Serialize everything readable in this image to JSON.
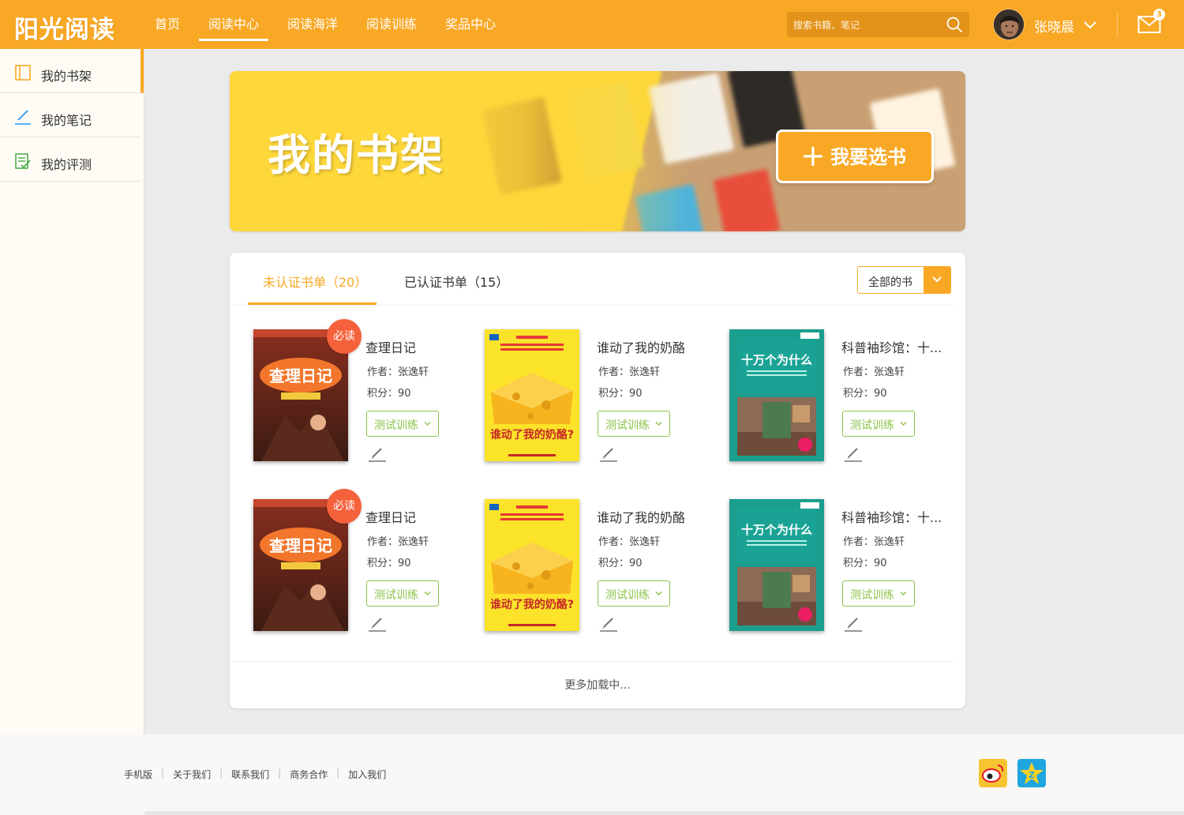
{
  "header": {
    "logo": "阳光阅读",
    "nav": [
      {
        "label": "首页",
        "active": false
      },
      {
        "label": "阅读中心",
        "active": true
      },
      {
        "label": "阅读海洋",
        "active": false
      },
      {
        "label": "阅读训练",
        "active": false
      },
      {
        "label": "奖品中心",
        "active": false
      }
    ],
    "search": {
      "placeholder": "搜索书籍、笔记",
      "icon": "search-icon"
    },
    "user": {
      "name": "张晓晨",
      "icon": "chevron-down-icon"
    },
    "mail": {
      "badge": "3",
      "icon": "mail-icon"
    }
  },
  "sidebar": {
    "items": [
      {
        "label": "我的书架",
        "icon": "bookshelf-icon",
        "active": true
      },
      {
        "label": "我的笔记",
        "icon": "pen-icon",
        "active": false
      },
      {
        "label": "我的评测",
        "icon": "checklist-icon",
        "active": false
      }
    ]
  },
  "banner": {
    "title": "我的书架",
    "button_plus": "+",
    "button_label": "我要选书"
  },
  "panel": {
    "tabs": [
      {
        "label": "未认证书单（20）",
        "active": true
      },
      {
        "label": "已认证书单（15）",
        "active": false
      }
    ],
    "filter": {
      "label": "全部的书"
    },
    "books": [
      {
        "title": "查理日记",
        "author": "作者：张逸轩",
        "points": "积分：90",
        "must": "必读",
        "test": "测试训练",
        "cover": "charlie"
      },
      {
        "title": "谁动了我的奶酪",
        "author": "作者：张逸轩",
        "points": "积分：90",
        "must": "",
        "test": "测试训练",
        "cover": "cheese"
      },
      {
        "title": "科普袖珍馆：十...",
        "author": "作者：张逸轩",
        "points": "积分：90",
        "must": "",
        "test": "测试训练",
        "cover": "why"
      },
      {
        "title": "查理日记",
        "author": "作者：张逸轩",
        "points": "积分：90",
        "must": "必读",
        "test": "测试训练",
        "cover": "charlie"
      },
      {
        "title": "谁动了我的奶酪",
        "author": "作者：张逸轩",
        "points": "积分：90",
        "must": "",
        "test": "测试训练",
        "cover": "cheese"
      },
      {
        "title": "科普袖珍馆：十...",
        "author": "作者：张逸轩",
        "points": "积分：90",
        "must": "",
        "test": "测试训练",
        "cover": "why"
      }
    ],
    "covers": {
      "charlie": {
        "text": "查理日记"
      },
      "cheese": {
        "text": "谁动了我的奶酪?"
      },
      "why": {
        "text": "十万个为什么"
      }
    },
    "more": "更多加载中..."
  },
  "footer": {
    "links": [
      "手机版",
      "关于我们",
      "联系我们",
      "商务合作",
      "加入我们"
    ],
    "social": [
      "weibo-icon",
      "qzone-icon"
    ]
  }
}
